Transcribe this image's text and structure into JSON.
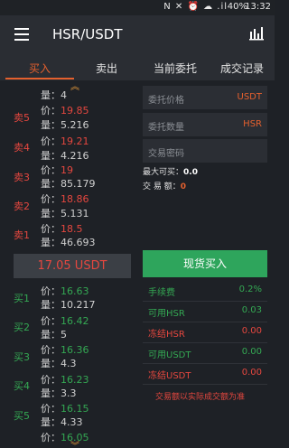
{
  "status_bar": {
    "icons": "N ✕ ⏰ ☁ .il",
    "battery": "40%",
    "time": "13:32"
  },
  "header": {
    "title": "HSR/USDT"
  },
  "tabs": [
    "买入",
    "卖出",
    "当前委托",
    "成交记录"
  ],
  "orderbook": {
    "price_label": "价：",
    "qty_label": "量：",
    "top_qty": "4",
    "asks": [
      {
        "label": "卖5",
        "price": "19.85",
        "qty": "5.216"
      },
      {
        "label": "卖4",
        "price": "19.21",
        "qty": "4.216"
      },
      {
        "label": "卖3",
        "price": "19",
        "qty": "85.179"
      },
      {
        "label": "卖2",
        "price": "18.86",
        "qty": "5.131"
      },
      {
        "label": "卖1",
        "price": "18.5",
        "qty": "46.693"
      }
    ],
    "current_price": "17.05 USDT",
    "bids": [
      {
        "label": "买1",
        "price": "16.63",
        "qty": "10.217"
      },
      {
        "label": "买2",
        "price": "16.42",
        "qty": "5"
      },
      {
        "label": "买3",
        "price": "16.36",
        "qty": "4.3"
      },
      {
        "label": "买4",
        "price": "16.23",
        "qty": "3.3"
      },
      {
        "label": "买5",
        "price": "16.15",
        "qty": "4.33"
      },
      {
        "label": "",
        "price": "16.05",
        "qty": ""
      }
    ]
  },
  "form": {
    "price_placeholder": "委托价格",
    "price_unit": "USDT",
    "qty_placeholder": "委托数量",
    "qty_unit": "HSR",
    "password_placeholder": "交易密码",
    "max_buy_label": "最大可买：",
    "max_buy_value": "0.0",
    "amount_label": "交 易 额：",
    "amount_value": "0",
    "buy_button": "现货买入",
    "stats": [
      {
        "label": "手续费",
        "value": "0.2%"
      },
      {
        "label": "可用HSR",
        "value": "0.03"
      },
      {
        "label": "冻结HSR",
        "value": "0.00"
      },
      {
        "label": "可用USDT",
        "value": "0.00"
      },
      {
        "label": "冻结USDT",
        "value": "0.00"
      }
    ],
    "note": "交易额以实际成交额为准"
  },
  "colors": {
    "accent": "#e4602e",
    "ask": "#e5473f",
    "bid": "#34a853",
    "background": "#1e2126"
  }
}
